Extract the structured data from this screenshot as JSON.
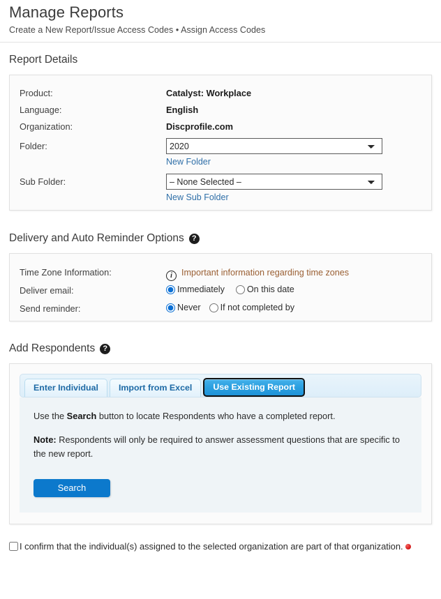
{
  "header": {
    "title": "Manage Reports",
    "subtitle": "Create a New Report/Issue Access Codes • Assign Access Codes"
  },
  "report_details": {
    "heading": "Report Details",
    "rows": [
      {
        "label": "Product:",
        "value": "Catalyst: Workplace"
      },
      {
        "label": "Language:",
        "value": "English"
      },
      {
        "label": "Organization:",
        "value": "Discprofile.com"
      }
    ],
    "folder": {
      "label": "Folder:",
      "selected": "2020",
      "options": [
        "2020"
      ],
      "link": "New Folder"
    },
    "sub_folder": {
      "label": "Sub Folder:",
      "selected": "– None Selected –",
      "options": [
        "– None Selected –"
      ],
      "link": "New Sub Folder"
    }
  },
  "delivery": {
    "heading": "Delivery and Auto Reminder Options",
    "help_glyph": "?",
    "time_zone": {
      "label": "Time Zone Information:",
      "info_glyph": "i",
      "note": "Important information regarding time zones",
      "note_color": "#9a5f33"
    },
    "deliver_email": {
      "label": "Deliver email:",
      "options": [
        {
          "label": "Immediately",
          "checked": true
        },
        {
          "label": "On this date",
          "checked": false
        }
      ]
    },
    "send_reminder": {
      "label": "Send reminder:",
      "options": [
        {
          "label": "Never",
          "checked": true
        },
        {
          "label": "If not completed by",
          "checked": false
        }
      ]
    }
  },
  "add_respondents": {
    "heading": "Add Respondents",
    "help_glyph": "?",
    "tabs": [
      {
        "label": "Enter Individual",
        "active": false
      },
      {
        "label": "Import from Excel",
        "active": false
      },
      {
        "label": "Use Existing Report",
        "active": true
      }
    ],
    "body_line_1_pre": "Use the ",
    "body_line_1_bold": "Search",
    "body_line_1_post": " button to locate Respondents who have a completed report.",
    "body_line_2_bold": "Note:",
    "body_line_2_post": " Respondents will only be required to answer assessment questions that are specific to the new report.",
    "search_button": "Search",
    "accent_color": "#0c79cc"
  },
  "confirm": {
    "text": "I confirm that the individual(s) assigned to the selected organization are part of that organization.",
    "checked": false,
    "required_marker_color": "#d91f1f"
  }
}
